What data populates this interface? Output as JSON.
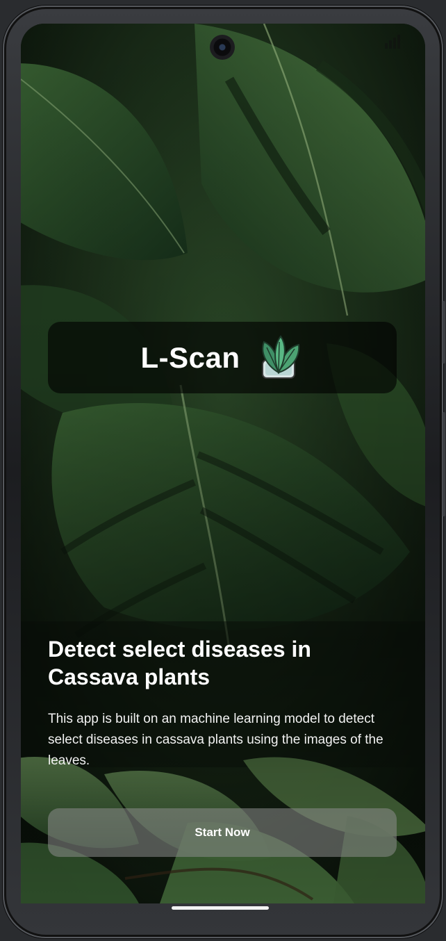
{
  "app": {
    "title": "L-Scan",
    "logo_icon": "leaf-plant-icon"
  },
  "hero": {
    "headline": "Detect select diseases in Cassava plants",
    "description": "This app is built on an machine learning model to detect select diseases in cassava plants using the images of the leaves."
  },
  "actions": {
    "start_label": "Start Now"
  },
  "colors": {
    "background_leaves": "#1f3a1e",
    "card_overlay": "#000000",
    "button_overlay": "#8c8c8c",
    "text": "#ffffff"
  }
}
